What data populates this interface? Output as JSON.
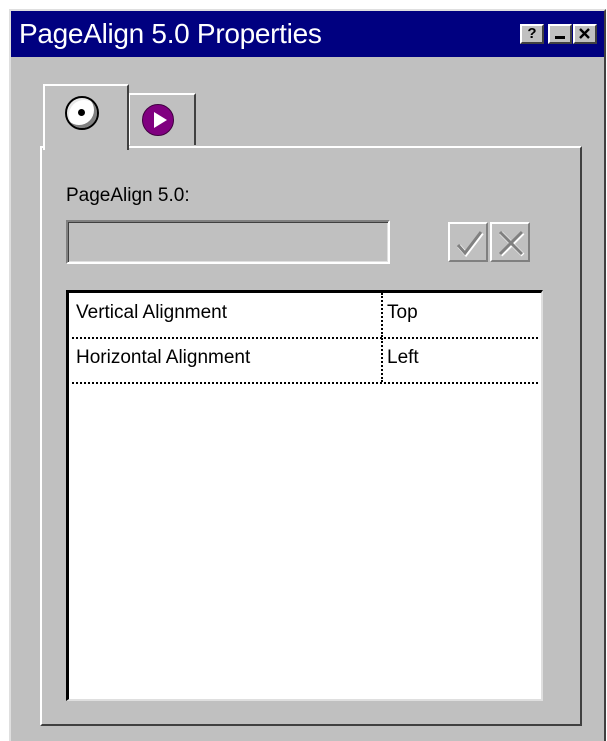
{
  "window": {
    "title": "PageAlign 5.0 Properties",
    "title_bar_color": "#000080",
    "controls": {
      "help": "?"
    }
  },
  "tabs": [
    {
      "icon": "disc-icon",
      "selected": true
    },
    {
      "icon": "play-icon",
      "selected": false,
      "icon_color": "#800080"
    }
  ],
  "panel": {
    "label": "PageAlign 5.0:",
    "input_value": "",
    "confirm_icon": "check-icon",
    "cancel_icon": "x-icon"
  },
  "properties": [
    {
      "name": "Vertical Alignment",
      "value": "Top"
    },
    {
      "name": "Horizontal Alignment",
      "value": "Left"
    }
  ]
}
